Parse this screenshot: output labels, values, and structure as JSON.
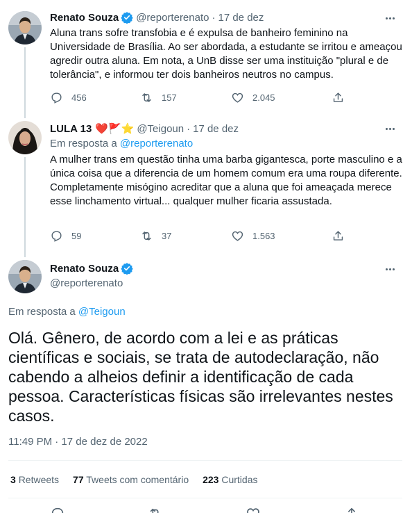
{
  "tweets": [
    {
      "name": "Renato Souza",
      "handle": "@reporterenato",
      "separator": "·",
      "date": "17 de dez",
      "text": "Aluna trans sofre transfobia e é expulsa de banheiro feminino na Universidade de Brasília. Ao ser abordada, a estudante se irritou e ameaçou agredir outra aluna. Em nota, a UnB disse ser uma instituição \"plural e de tolerância\", e informou ter dois banheiros neutros no campus.",
      "replies": "456",
      "retweets": "157",
      "likes": "2.045"
    },
    {
      "name": "LULA 13",
      "emojis": "❤️🚩⭐",
      "handle": "@Teigoun",
      "separator": "·",
      "date": "17 de dez",
      "reply_prefix": "Em resposta a",
      "reply_to": "@reporterenato",
      "text": "A mulher trans em questão tinha uma barba gigantesca, porte masculino e a única coisa que a diferencia de um homem comum era uma roupa diferente. Completamente misógino acreditar que a aluna que foi ameaçada merece esse linchamento virtual... qualquer mulher ficaria assustada.",
      "replies": "59",
      "retweets": "37",
      "likes": "1.563"
    }
  ],
  "main_tweet": {
    "name": "Renato Souza",
    "handle": "@reporterenato",
    "reply_prefix": "Em resposta a",
    "reply_to": "@Teigoun",
    "text": "Olá. Gênero, de acordo com a lei e as práticas científicas e sociais, se trata de autodeclaração, não cabendo a alheios definir a identificação de cada pessoa. Características físicas são irrelevantes nestes casos.",
    "timestamp": "11:49 PM · 17 de dez de 2022",
    "retweets_count": "3",
    "retweets_label": "Retweets",
    "quotes_count": "77",
    "quotes_label": "Tweets com comentário",
    "likes_count": "223",
    "likes_label": "Curtidas"
  },
  "colors": {
    "accent": "#1d9bf0",
    "secondary_text": "#536471",
    "thread_line": "#cfd9de"
  },
  "icons": [
    "verified-badge-icon",
    "more-icon",
    "reply-icon",
    "retweet-icon",
    "like-icon",
    "share-icon"
  ]
}
